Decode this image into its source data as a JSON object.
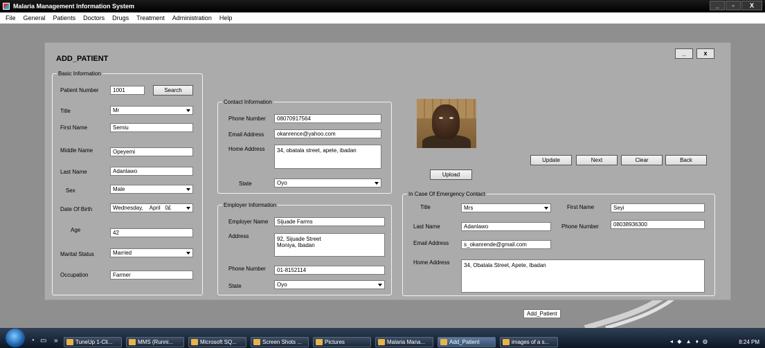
{
  "window": {
    "title": "Malaria Management Information System",
    "controls": {
      "minimize": "_",
      "maximize": "▫",
      "close": "X"
    }
  },
  "menu": [
    "File",
    "General",
    "Patients",
    "Doctors",
    "Drugs",
    "Treatment",
    "Administration",
    "Help"
  ],
  "form": {
    "title": "ADD_PATIENT",
    "minimize_label": "_",
    "close_label": "x",
    "basic": {
      "legend": "Basic Information",
      "patient_number_label": "Patient Number",
      "patient_number": "1001",
      "search_label": "Search",
      "title_label": "Title",
      "title": "Mr",
      "first_name_label": "First Name",
      "first_name": "Semiu",
      "middle_name_label": "Middle Name",
      "middle_name": "Opeyemi",
      "last_name_label": "Last Name",
      "last_name": "Adanlawo",
      "sex_label": "Sex",
      "sex": "Male",
      "dob_label": "Date Of Birth",
      "dob_day": "Wednesday,",
      "dob_month": "April",
      "dob_date": "0£",
      "age_label": "Age",
      "age": "42",
      "marital_label": "Marital Status",
      "marital": "Married",
      "occupation_label": "Occupation",
      "occupation": "Farmer"
    },
    "contact": {
      "legend": "Contact Information",
      "phone_label": "Phone Number",
      "phone": "08070917564",
      "email_label": "Email Address",
      "email": "okanrence@yahoo.com",
      "address_label": "Home Address",
      "address": "34, obatala street, apete, ibadan",
      "state_label": "State",
      "state": "Oyo"
    },
    "employer": {
      "legend": "Employer Information",
      "name_label": "Employer Name",
      "name": "Sijuade Farms",
      "address_label": "Address",
      "address": "92, Sijuade Street\nMoniya, Ibadan",
      "phone_label": "Phone Number",
      "phone": "01-8152114",
      "state_label": "State",
      "state": "Oyo"
    },
    "upload_label": "Upload",
    "actions": {
      "update": "Update",
      "next": "Next",
      "clear": "Clear",
      "back": "Back"
    },
    "emergency": {
      "legend": "In Case Of Emergency Contact",
      "title_label": "Title",
      "title": "Mrs",
      "first_name_label": "First Name",
      "first_name": "Seyi",
      "last_name_label": "Last Name",
      "last_name": "Adanlawo",
      "phone_label": "Phone Number",
      "phone": "08038936300",
      "email_label": "Email Address",
      "email": "s_okanrende@gmail.com",
      "address_label": "Home Address",
      "address": "34, Obatala Street, Apete, Ibadan"
    }
  },
  "tooltip": "Add_Patient",
  "taskbar": {
    "items": [
      {
        "label": "TuneUp 1-Cli..."
      },
      {
        "label": "MMS (Runni..."
      },
      {
        "label": "Microsoft SQ..."
      },
      {
        "label": "Screen Shots ..."
      },
      {
        "label": "Pictures"
      },
      {
        "label": "Malaria Mana..."
      },
      {
        "label": "Add_Patient"
      },
      {
        "label": "images of a s..."
      }
    ],
    "clock": "8:24 PM",
    "chevrons": "»"
  }
}
